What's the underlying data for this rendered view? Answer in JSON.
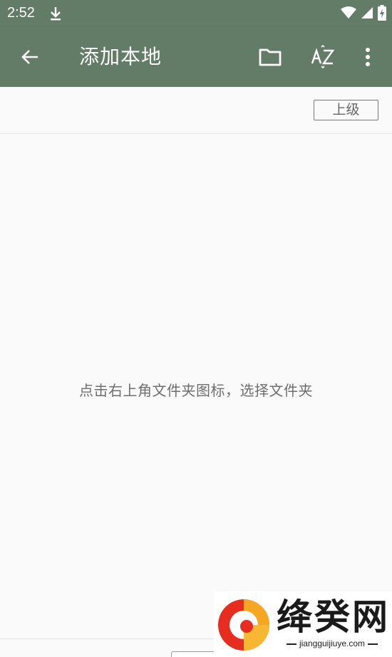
{
  "status_bar": {
    "time": "2:52",
    "download_icon": "download-icon",
    "wifi_icon": "wifi-icon",
    "signal_icon": "signal-icon",
    "battery_icon": "battery-charging-icon"
  },
  "app_bar": {
    "title": "添加本地",
    "back_icon": "arrow-back-icon",
    "folder_icon": "folder-icon",
    "sort_icon": "sort-az-icon",
    "more_icon": "more-vert-icon",
    "color": "#637c67"
  },
  "path_bar": {
    "up_label": "上级"
  },
  "content": {
    "empty_hint": "点击右上角文件夹图标，选择文件夹"
  },
  "watermark": {
    "name": "绛癸网",
    "url": "jiangguijiuye.com"
  }
}
